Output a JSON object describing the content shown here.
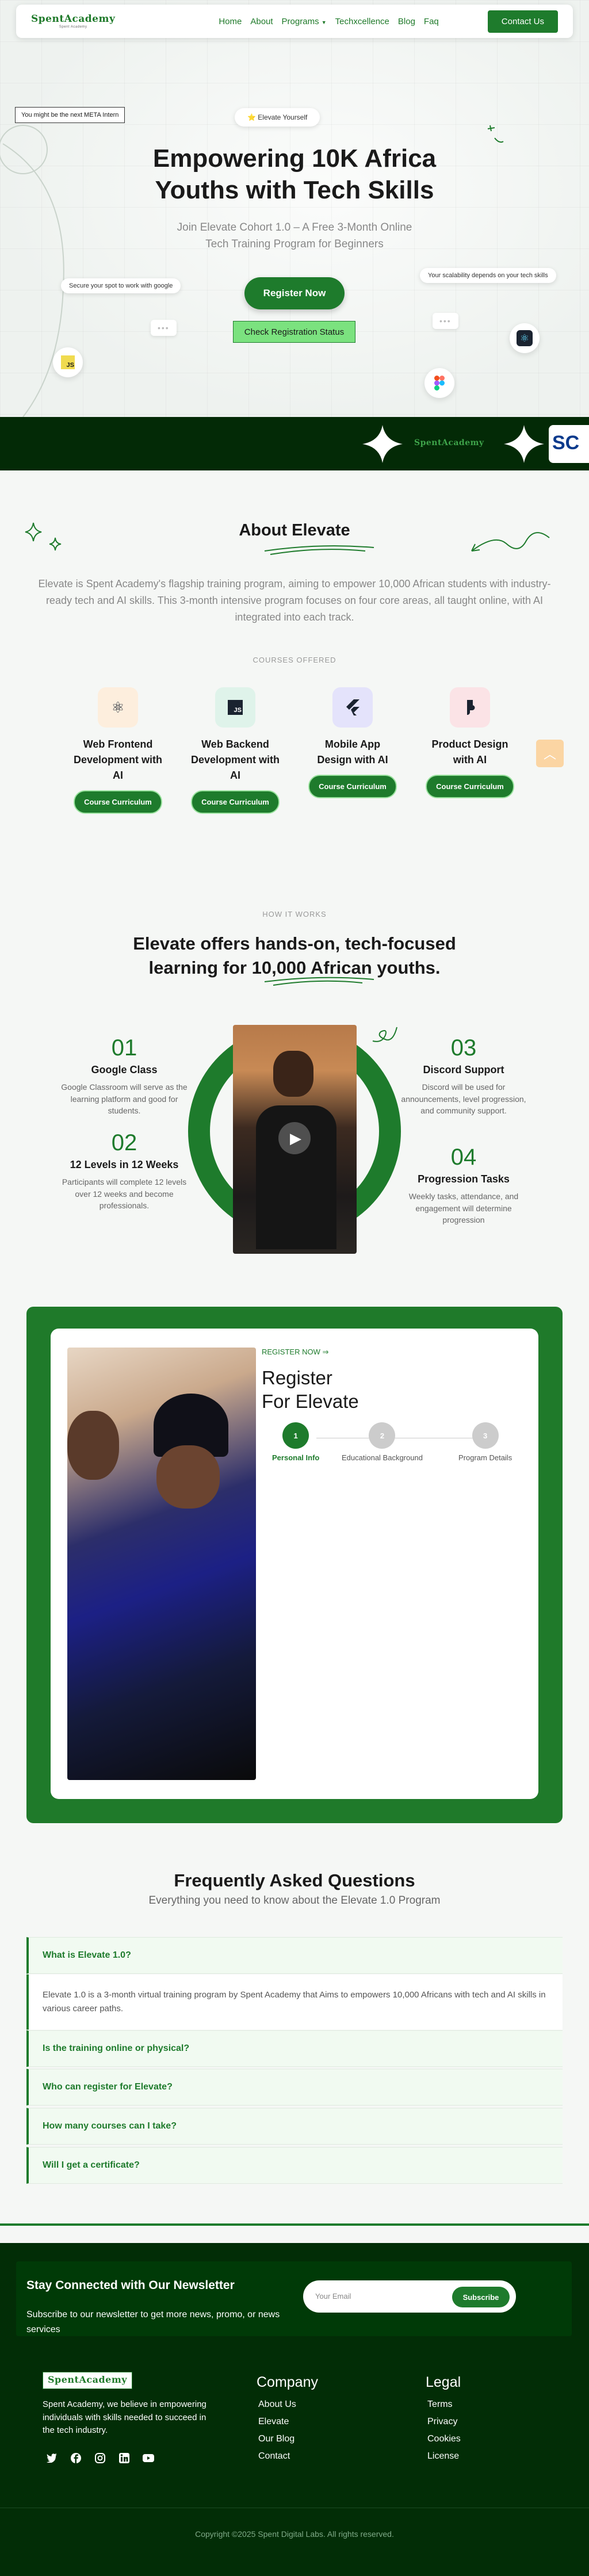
{
  "nav": {
    "logo": "SpentAcademy",
    "logo_tagline": "Spent Academy",
    "links": [
      "Home",
      "About",
      "Programs",
      "Techxcellence",
      "Blog",
      "Faq"
    ],
    "contact": "Contact Us"
  },
  "hero": {
    "tag": "You might be the next META Intern",
    "badge_emoji": "⭐",
    "badge": "Elevate Yourself",
    "title_line1": "Empowering 10K Africa",
    "title_line2": "Youths with Tech Skills",
    "sub_line1": "Join Elevate Cohort 1.0 – A Free 3-Month Online",
    "sub_line2": "Tech Training Program for Beginners",
    "register": "Register Now",
    "check_status": "Check Registration Status",
    "pill_left": "Secure your spot to work with google",
    "pill_right": "Your scalability depends on your tech skills",
    "js_label": "JS"
  },
  "strip": {
    "logo": "SpentAcademy",
    "sc": "SC"
  },
  "about": {
    "title": "About Elevate",
    "description": "Elevate is Spent Academy's flagship training program, aiming to empower 10,000 African students with industry-ready tech and AI skills. This 3-month intensive program focuses on four core areas, all taught online, with AI integrated into each track.",
    "courses_label": "COURSES OFFERED",
    "courses": [
      {
        "name": "Web Frontend Development with AI",
        "button": "Course Curriculum",
        "icon": "react-icon",
        "bg": "#fdeedd"
      },
      {
        "name": "Web Backend Development with AI",
        "button": "Course Curriculum",
        "icon": "js-icon",
        "bg": "#dff3ea"
      },
      {
        "name": "Mobile App Design with AI",
        "button": "Course Curriculum",
        "icon": "flutter-icon",
        "bg": "#e4e3fb"
      },
      {
        "name": "Product Design with AI",
        "button": "Course Curriculum",
        "icon": "figma-icon",
        "bg": "#fbe3e6"
      }
    ]
  },
  "how": {
    "label": "HOW IT WORKS",
    "title_line1": "Elevate offers hands-on, tech-focused",
    "title_line2": "learning for 10,000 African youths.",
    "steps": [
      {
        "num": "01",
        "title": "Google Class",
        "desc": "Google Classroom will serve as the learning platform and good for students."
      },
      {
        "num": "02",
        "title": "12 Levels in 12 Weeks",
        "desc": "Participants will complete 12 levels over 12 weeks and become professionals."
      },
      {
        "num": "03",
        "title": "Discord Support",
        "desc": "Discord will be used for announcements, level progression, and community support."
      },
      {
        "num": "04",
        "title": "Progression Tasks",
        "desc": "Weekly tasks, attendance, and engagement will determine progression"
      }
    ]
  },
  "register": {
    "label": "REGISTER NOW",
    "title_line1": "Register",
    "title_line2": "For Elevate",
    "steps": [
      {
        "num": "1",
        "label": "Personal Info"
      },
      {
        "num": "2",
        "label": "Educational Background"
      },
      {
        "num": "3",
        "label": "Program Details"
      }
    ]
  },
  "faq": {
    "title": "Frequently Asked Questions",
    "subtitle": "Everything you need to know about the Elevate 1.0 Program",
    "items": [
      {
        "q": "What is Elevate 1.0?",
        "a": "Elevate 1.0 is a 3-month virtual training program by Spent Academy that Aims to empowers 10,000 Africans with tech and AI skills in various career paths."
      },
      {
        "q": "Is the training online or physical?"
      },
      {
        "q": "Who can register for Elevate?"
      },
      {
        "q": "How many courses can I take?"
      },
      {
        "q": "Will I get a certificate?"
      }
    ]
  },
  "newsletter": {
    "title": "Stay Connected with Our Newsletter",
    "desc": "Subscribe to our newsletter to get more news, promo, or news services",
    "placeholder": "Your Email",
    "button": "Subscribe"
  },
  "footer": {
    "logo": "SpentAcademy",
    "desc": "Spent Academy, we believe in empowering individuals with skills needed to succeed in the tech industry.",
    "company_title": "Company",
    "company_links": [
      "About Us",
      "Elevate",
      "Our Blog",
      "Contact"
    ],
    "legal_title": "Legal",
    "legal_links": [
      "Terms",
      "Privacy",
      "Cookies",
      "License"
    ],
    "social": [
      "twitter-icon",
      "facebook-icon",
      "instagram-icon",
      "linkedin-icon",
      "youtube-icon"
    ],
    "copyright": "Copyright ©2025 Spent Digital Labs. All rights reserved."
  }
}
